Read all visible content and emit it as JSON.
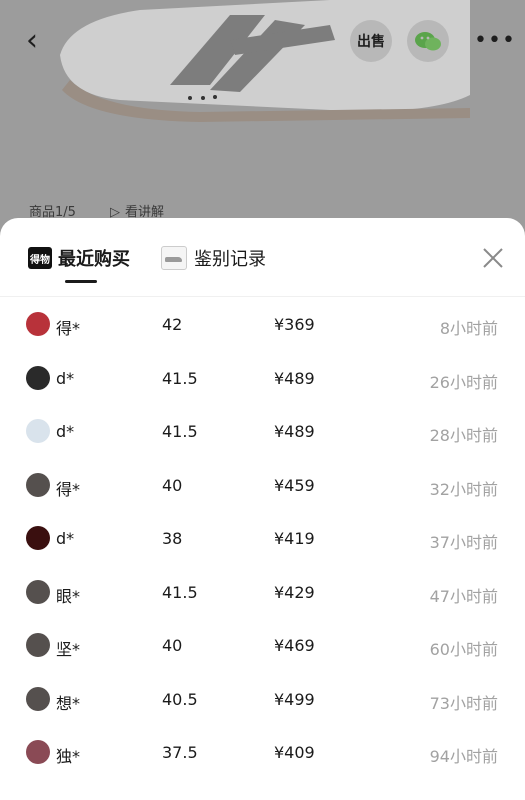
{
  "header": {
    "back_icon": "chevron-left-icon",
    "sell_label": "出售",
    "wechat_icon": "wechat-icon",
    "more_icon": "more-icon"
  },
  "product": {
    "counter": "商品1/5",
    "watch_explain": "看讲解"
  },
  "sheet": {
    "tabs": [
      {
        "label": "最近购买",
        "badge": "得物",
        "active": true
      },
      {
        "label": "鉴别记录",
        "active": false
      }
    ],
    "close_icon": "close-icon",
    "purchases": [
      {
        "name": "得*",
        "size": "42",
        "price": "¥369",
        "time": "8小时前",
        "avatar_color": "#b8323a"
      },
      {
        "name": "d*",
        "size": "41.5",
        "price": "¥489",
        "time": "26小时前",
        "avatar_color": "#2a2a2a"
      },
      {
        "name": "d*",
        "size": "41.5",
        "price": "¥489",
        "time": "28小时前",
        "avatar_color": "#d9e3ec"
      },
      {
        "name": "得*",
        "size": "40",
        "price": "¥459",
        "time": "32小时前",
        "avatar_color": "#55504e"
      },
      {
        "name": "d*",
        "size": "38",
        "price": "¥419",
        "time": "37小时前",
        "avatar_color": "#3a0f0f"
      },
      {
        "name": "眼*",
        "size": "41.5",
        "price": "¥429",
        "time": "47小时前",
        "avatar_color": "#55504e"
      },
      {
        "name": "坚*",
        "size": "40",
        "price": "¥469",
        "time": "60小时前",
        "avatar_color": "#55504e"
      },
      {
        "name": "想*",
        "size": "40.5",
        "price": "¥499",
        "time": "73小时前",
        "avatar_color": "#55504e"
      },
      {
        "name": "独*",
        "size": "37.5",
        "price": "¥409",
        "time": "94小时前",
        "avatar_color": "#8a4a55"
      }
    ]
  }
}
